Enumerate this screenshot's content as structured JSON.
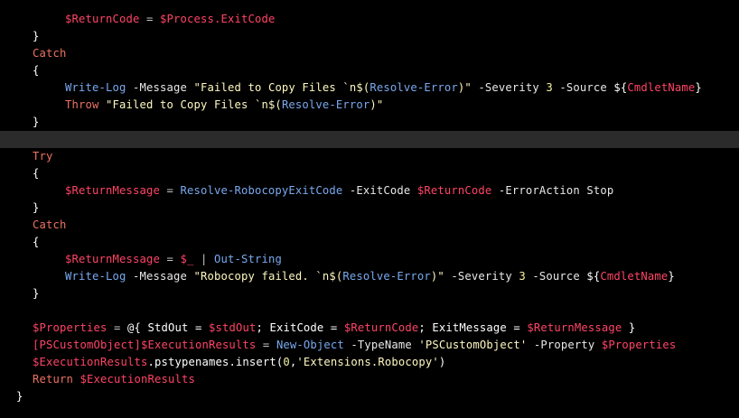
{
  "editor": {
    "language": "powershell",
    "current_line_index": 7,
    "colors": {
      "background": "#000000",
      "current_line": "#2b2b2b",
      "plain": "#ffffff",
      "variable": "#ff4466",
      "keyword": "#ec7262",
      "cmdlet": "#79a9ef",
      "string": "#fff8c0",
      "number": "#f7f39e",
      "operator": "#c4c4c4"
    },
    "lines": [
      {
        "indent": 4,
        "tokens": [
          {
            "t": "$ReturnCode",
            "c": "var"
          },
          {
            "t": " = ",
            "c": "operator"
          },
          {
            "t": "$Process.ExitCode",
            "c": "var"
          }
        ]
      },
      {
        "indent": 2,
        "tokens": [
          {
            "t": "}",
            "c": "plain"
          }
        ]
      },
      {
        "indent": 2,
        "tokens": [
          {
            "t": "Catch",
            "c": "keyword"
          }
        ]
      },
      {
        "indent": 2,
        "tokens": [
          {
            "t": "{",
            "c": "plain"
          }
        ]
      },
      {
        "indent": 4,
        "tokens": [
          {
            "t": "Write-Log",
            "c": "cmdlet"
          },
          {
            "t": " -Message ",
            "c": "param"
          },
          {
            "t": "\"Failed to Copy Files `n$(",
            "c": "string"
          },
          {
            "t": "Resolve-Error",
            "c": "cmdlet"
          },
          {
            "t": ")\"",
            "c": "string"
          },
          {
            "t": " -Severity ",
            "c": "param"
          },
          {
            "t": "3",
            "c": "number"
          },
          {
            "t": " -Source ",
            "c": "param"
          },
          {
            "t": "${",
            "c": "plain"
          },
          {
            "t": "CmdletName",
            "c": "var"
          },
          {
            "t": "}",
            "c": "plain"
          }
        ]
      },
      {
        "indent": 4,
        "tokens": [
          {
            "t": "Throw",
            "c": "keyword"
          },
          {
            "t": " ",
            "c": "plain"
          },
          {
            "t": "\"Failed to Copy Files `n$(",
            "c": "string"
          },
          {
            "t": "Resolve-Error",
            "c": "cmdlet"
          },
          {
            "t": ")\"",
            "c": "string"
          }
        ]
      },
      {
        "indent": 2,
        "tokens": [
          {
            "t": "}",
            "c": "plain"
          }
        ]
      },
      {
        "indent": 0,
        "tokens": []
      },
      {
        "indent": 2,
        "tokens": [
          {
            "t": "Try",
            "c": "keyword"
          }
        ]
      },
      {
        "indent": 2,
        "tokens": [
          {
            "t": "{",
            "c": "plain"
          }
        ]
      },
      {
        "indent": 4,
        "tokens": [
          {
            "t": "$ReturnMessage",
            "c": "var"
          },
          {
            "t": " = ",
            "c": "operator"
          },
          {
            "t": "Resolve-RobocopyExitCode",
            "c": "cmdlet"
          },
          {
            "t": " -ExitCode ",
            "c": "param"
          },
          {
            "t": "$ReturnCode",
            "c": "var"
          },
          {
            "t": " -ErrorAction Stop",
            "c": "param"
          }
        ]
      },
      {
        "indent": 2,
        "tokens": [
          {
            "t": "}",
            "c": "plain"
          }
        ]
      },
      {
        "indent": 2,
        "tokens": [
          {
            "t": "Catch",
            "c": "keyword"
          }
        ]
      },
      {
        "indent": 2,
        "tokens": [
          {
            "t": "{",
            "c": "plain"
          }
        ]
      },
      {
        "indent": 4,
        "tokens": [
          {
            "t": "$ReturnMessage",
            "c": "var"
          },
          {
            "t": " = ",
            "c": "operator"
          },
          {
            "t": "$_",
            "c": "var"
          },
          {
            "t": " | ",
            "c": "operator"
          },
          {
            "t": "Out-String",
            "c": "cmdlet"
          }
        ]
      },
      {
        "indent": 4,
        "tokens": [
          {
            "t": "Write-Log",
            "c": "cmdlet"
          },
          {
            "t": " -Message ",
            "c": "param"
          },
          {
            "t": "\"Robocopy failed. `n$(",
            "c": "string"
          },
          {
            "t": "Resolve-Error",
            "c": "cmdlet"
          },
          {
            "t": ")\"",
            "c": "string"
          },
          {
            "t": " -Severity ",
            "c": "param"
          },
          {
            "t": "3",
            "c": "number"
          },
          {
            "t": " -Source ",
            "c": "param"
          },
          {
            "t": "${",
            "c": "plain"
          },
          {
            "t": "CmdletName",
            "c": "var"
          },
          {
            "t": "}",
            "c": "plain"
          }
        ]
      },
      {
        "indent": 2,
        "tokens": [
          {
            "t": "}",
            "c": "plain"
          }
        ]
      },
      {
        "indent": 0,
        "tokens": []
      },
      {
        "indent": 2,
        "tokens": [
          {
            "t": "$Properties",
            "c": "var"
          },
          {
            "t": " = ",
            "c": "operator"
          },
          {
            "t": "@{ StdOut = ",
            "c": "plain"
          },
          {
            "t": "$stdOut",
            "c": "var"
          },
          {
            "t": "; ExitCode = ",
            "c": "plain"
          },
          {
            "t": "$ReturnCode",
            "c": "var"
          },
          {
            "t": "; ExitMessage = ",
            "c": "plain"
          },
          {
            "t": "$ReturnMessage",
            "c": "var"
          },
          {
            "t": " }",
            "c": "plain"
          }
        ]
      },
      {
        "indent": 2,
        "tokens": [
          {
            "t": "[PSCustomObject]",
            "c": "type"
          },
          {
            "t": "$ExecutionResults",
            "c": "var"
          },
          {
            "t": " = ",
            "c": "operator"
          },
          {
            "t": "New-Object",
            "c": "cmdlet"
          },
          {
            "t": " -TypeName ",
            "c": "param"
          },
          {
            "t": "'PSCustomObject'",
            "c": "string"
          },
          {
            "t": " -Property ",
            "c": "param"
          },
          {
            "t": "$Properties",
            "c": "var"
          }
        ]
      },
      {
        "indent": 2,
        "tokens": [
          {
            "t": "$ExecutionResults",
            "c": "var"
          },
          {
            "t": ".pstypenames.insert(",
            "c": "plain"
          },
          {
            "t": "0",
            "c": "number"
          },
          {
            "t": ",",
            "c": "plain"
          },
          {
            "t": "'Extensions.Robocopy'",
            "c": "string"
          },
          {
            "t": ")",
            "c": "plain"
          }
        ]
      },
      {
        "indent": 2,
        "tokens": [
          {
            "t": "Return",
            "c": "keyword"
          },
          {
            "t": " ",
            "c": "plain"
          },
          {
            "t": "$ExecutionResults",
            "c": "var"
          }
        ]
      },
      {
        "indent": 1,
        "tokens": [
          {
            "t": "}",
            "c": "plain"
          }
        ]
      }
    ]
  }
}
